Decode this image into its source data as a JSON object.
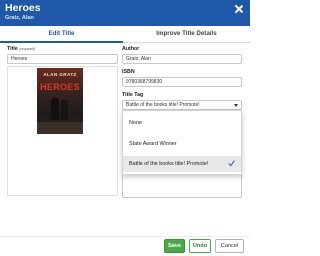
{
  "header": {
    "title": "Heroes",
    "author": "Gratz, Alan",
    "bg_color": "#1f58a8"
  },
  "tabs": [
    {
      "label": "Edit Title",
      "active": true
    },
    {
      "label": "Improve Title Details",
      "active": false
    }
  ],
  "form": {
    "title": {
      "label": "Title",
      "required_note": "(required)",
      "value": "Heroes"
    },
    "author": {
      "label": "Author",
      "value": "Gratz, Alan"
    },
    "isbn": {
      "label": "ISBN",
      "value": "9780368799830"
    },
    "title_tag": {
      "label": "Title Tag",
      "value": "Battle of the books title! Promote!",
      "options": [
        {
          "label": "None",
          "selected": false
        },
        {
          "label": "State Award Winner",
          "selected": false
        },
        {
          "label": "Battle of the books title! Promote!",
          "selected": true
        }
      ]
    }
  },
  "cover": {
    "author_text": "ALAN GRATZ",
    "title_text": "HEROES"
  },
  "buttons": {
    "save": "Save",
    "undo": "Undo",
    "cancel": "Cancel"
  },
  "colors": {
    "accent": "#1f58a8",
    "save": "#4aa84a"
  }
}
